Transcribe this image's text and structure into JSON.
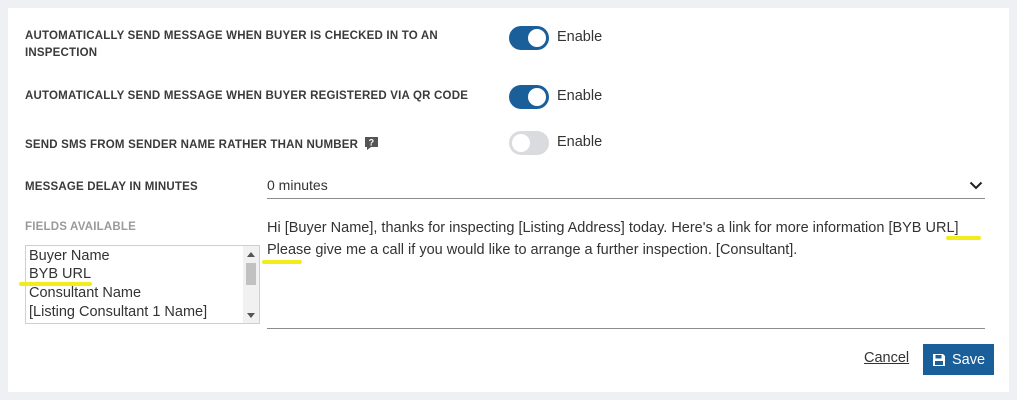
{
  "settings": [
    {
      "label": "AUTOMATICALLY SEND MESSAGE WHEN BUYER IS CHECKED IN TO AN INSPECTION",
      "toggle_label": "Enable",
      "enabled": true
    },
    {
      "label": "AUTOMATICALLY SEND MESSAGE WHEN BUYER REGISTERED VIA QR CODE",
      "toggle_label": "Enable",
      "enabled": true
    },
    {
      "label": "SEND SMS FROM SENDER NAME RATHER THAN NUMBER",
      "toggle_label": "Enable",
      "enabled": false,
      "icon": "help-icon"
    }
  ],
  "delay": {
    "label": "MESSAGE DELAY IN MINUTES",
    "value": "0 minutes",
    "icon": "chevron-down-icon"
  },
  "fields": {
    "heading": "FIELDS AVAILABLE",
    "items": [
      "Buyer Name",
      "BYB URL",
      "Consultant Name",
      "[Listing Consultant 1 Name]"
    ]
  },
  "message": {
    "text": "Hi [Buyer Name], thanks for inspecting [Listing Address] today. Here's a link for more information [BYB URL] Please give me a call if you would like to arrange a further inspection. [Consultant]."
  },
  "actions": {
    "cancel": "Cancel",
    "save": "Save",
    "save_icon": "floppy-disk-icon"
  },
  "colors": {
    "accent": "#1b5f9a",
    "highlight": "#f2ec1c",
    "toggle_off": "#d9dbde"
  }
}
